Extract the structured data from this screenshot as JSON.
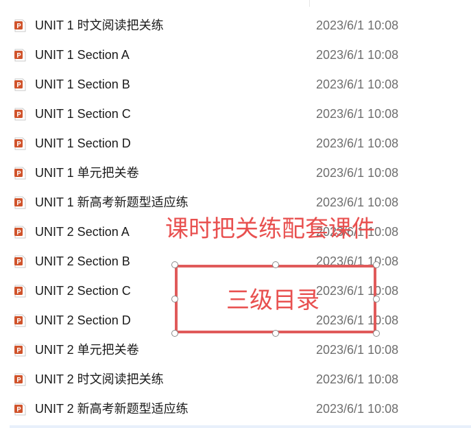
{
  "files": [
    {
      "name": "UNIT 1  时文阅读把关练",
      "date": "2023/6/1 10:08",
      "icon": "powerpoint-file-icon"
    },
    {
      "name": "UNIT 1 Section A",
      "date": "2023/6/1 10:08",
      "icon": "powerpoint-file-icon"
    },
    {
      "name": "UNIT 1 Section B",
      "date": "2023/6/1 10:08",
      "icon": "powerpoint-file-icon"
    },
    {
      "name": "UNIT 1 Section C",
      "date": "2023/6/1 10:08",
      "icon": "powerpoint-file-icon"
    },
    {
      "name": "UNIT 1 Section D",
      "date": "2023/6/1 10:08",
      "icon": "powerpoint-file-icon"
    },
    {
      "name": "UNIT 1 单元把关卷",
      "date": "2023/6/1 10:08",
      "icon": "powerpoint-file-icon"
    },
    {
      "name": "UNIT 1 新高考新题型适应练",
      "date": "2023/6/1 10:08",
      "icon": "powerpoint-file-icon"
    },
    {
      "name": "UNIT 2 Section A",
      "date": "2023/6/1 10:08",
      "icon": "powerpoint-file-icon"
    },
    {
      "name": "UNIT 2 Section B",
      "date": "2023/6/1 10:08",
      "icon": "powerpoint-file-icon"
    },
    {
      "name": "UNIT 2 Section C",
      "date": "2023/6/1 10:08",
      "icon": "powerpoint-file-icon"
    },
    {
      "name": "UNIT 2 Section D",
      "date": "2023/6/1 10:08",
      "icon": "powerpoint-file-icon"
    },
    {
      "name": "UNIT 2 单元把关卷",
      "date": "2023/6/1 10:08",
      "icon": "powerpoint-file-icon"
    },
    {
      "name": "UNIT 2 时文阅读把关练",
      "date": "2023/6/1 10:08",
      "icon": "powerpoint-file-icon"
    },
    {
      "name": "UNIT 2 新高考新题型适应练",
      "date": "2023/6/1 10:08",
      "icon": "powerpoint-file-icon"
    }
  ],
  "overlay": {
    "caption": "课时把关练配套课件",
    "box_label": "三级目录",
    "color": "#e8504f"
  },
  "colors": {
    "icon_orange": "#d0532b",
    "name_text": "#1a1a1a",
    "date_text": "#6e6e6e"
  }
}
